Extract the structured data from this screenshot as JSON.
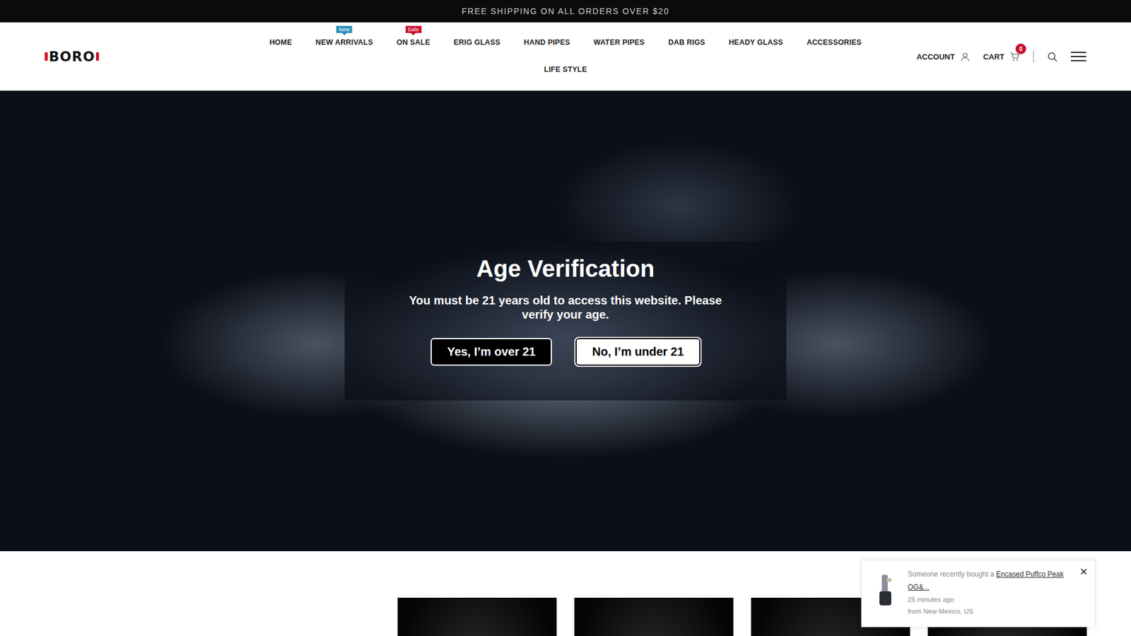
{
  "announcement": "FREE SHIPPING ON ALL ORDERS OVER $20",
  "logo": "BORO",
  "nav": [
    {
      "label": "HOME"
    },
    {
      "label": "NEW ARRIVALS",
      "badge": {
        "text": "New",
        "color": "#2a8fb5"
      }
    },
    {
      "label": "ON SALE",
      "badge": {
        "text": "Sale",
        "color": "#c8102e"
      }
    },
    {
      "label": "ERIG GLASS"
    },
    {
      "label": "HAND PIPES"
    },
    {
      "label": "WATER PIPES"
    },
    {
      "label": "DAB RIGS"
    },
    {
      "label": "HEADY GLASS"
    },
    {
      "label": "ACCESSORIES"
    },
    {
      "label": "LIFE STYLE"
    }
  ],
  "header_actions": {
    "account": "ACCOUNT",
    "cart": "CART",
    "cart_count": "0"
  },
  "modal": {
    "title": "Age Verification",
    "message": "You must be 21 years old to access this website. Please verify your age.",
    "buttons": [
      {
        "label": "Yes, I’m over 21",
        "kind": "primary"
      },
      {
        "label": "No, I’m under 21",
        "kind": "secondary"
      }
    ]
  },
  "notification": {
    "prefix": "Someone recently bought a",
    "product": "Encased Puffco Peak OG&...",
    "time": "25 minutes ago",
    "location": "from New Mexico, US",
    "close": "×"
  }
}
